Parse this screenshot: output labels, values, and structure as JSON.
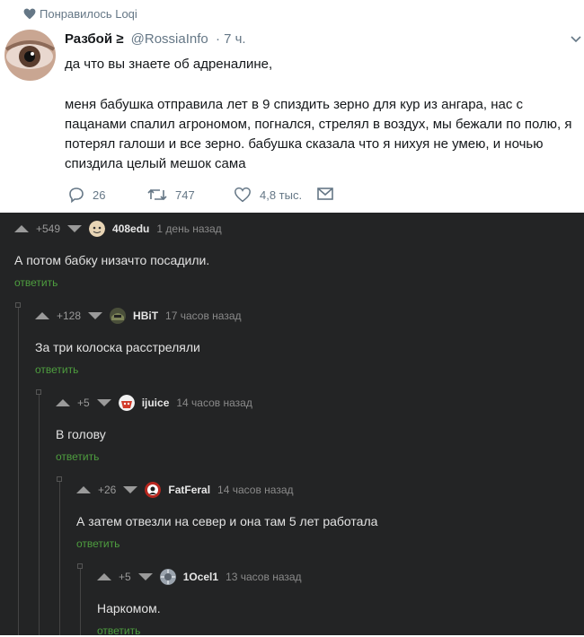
{
  "tweet": {
    "liked_label": "Понравилось Loqi",
    "author_name": "Разбой",
    "author_badge": "≥",
    "handle": "@RossiaInfo",
    "time": "· 7 ч.",
    "text_line1": "да что вы знаете об адреналине,",
    "text_para2": "меня бабушка отправила лет в 9 спиздить зерно для кур из ангара, нас с пацанами спалил агрономом, погнался, стрелял в воздух, мы бежали по полю, я потерял галоши и все зерно. бабушка сказала что я нихуя не умею, и ночью спиздила целый мешок сама",
    "replies_count": "26",
    "retweets_count": "747",
    "likes_count": "4,8 тыс.",
    "icons": [
      "heart-icon",
      "chevron-down-icon",
      "reply-icon",
      "retweet-icon",
      "like-icon",
      "message-icon"
    ]
  },
  "comments": [
    {
      "rating": "+549",
      "user": "408edu",
      "time": "1 день назад",
      "text": "А потом бабку низачто посадили.",
      "reply": "ответить"
    },
    {
      "rating": "+128",
      "user": "HBiT",
      "time": "17 часов назад",
      "text": "За три колоска расстреляли",
      "reply": "ответить"
    },
    {
      "rating": "+5",
      "user": "ijuice",
      "time": "14 часов назад",
      "text": "В голову",
      "reply": "ответить"
    },
    {
      "rating": "+26",
      "user": "FatFeral",
      "time": "14 часов назад",
      "text": "А затем отвезли на север и она там 5 лет работала",
      "reply": "ответить"
    },
    {
      "rating": "+5",
      "user": "1Ocel1",
      "time": "13 часов назад",
      "text": "Наркомом.",
      "reply": "ответить"
    }
  ],
  "colors": {
    "reply_link": "#4e9e3f",
    "comments_bg": "#232425",
    "tweet_meta": "#657786"
  }
}
